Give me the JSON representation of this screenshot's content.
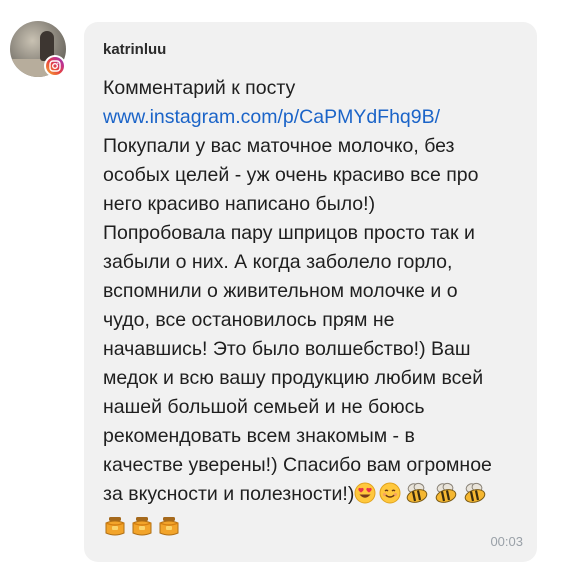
{
  "message": {
    "username": "katrinluu",
    "lines": [
      "Комментарий к посту",
      "www.instagram.com/p/CaPMYdFhq9B/",
      "Покупали у вас маточное молочко, без",
      "особых целей - уж очень красиво все про",
      "него красиво написано было!)",
      "Попробовала пару шприцов просто так и",
      "забыли о них. А когда заболело горло,",
      "вспомнили о живительном молочке и о",
      "чудо, все остановилось прям не",
      "начавшись! Это было волшебство!) Ваш",
      "медок и всю вашу продукцию любим всей",
      "нашей большой семьей и не боюсь",
      "рекомендовать всем знакомым - в",
      "качестве уверены!) Спасибо вам огромное",
      "за вкусности и полезности!)"
    ],
    "emoji_row_1": [
      "heart-eyes-emoji",
      "smiling-face-emoji",
      "bee-emoji",
      "bee-emoji",
      "bee-emoji"
    ],
    "emoji_row_2": [
      "honey-pot-emoji",
      "honey-pot-emoji",
      "honey-pot-emoji"
    ],
    "time": "00:03"
  },
  "colors": {
    "bubble": "#f1f1f1",
    "link": "#1b64c8",
    "text": "#1f1f1f",
    "time": "#9aa1a8"
  },
  "icons": {
    "source_badge": "instagram-icon"
  }
}
